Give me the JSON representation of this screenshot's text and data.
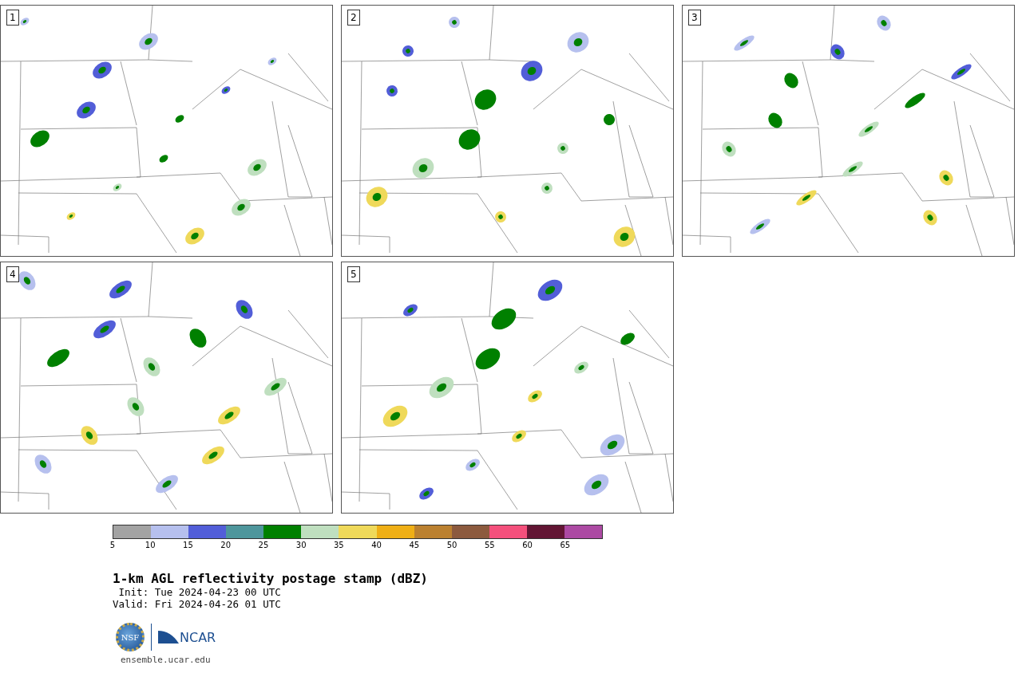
{
  "panels": [
    {
      "label": "1"
    },
    {
      "label": "2"
    },
    {
      "label": "3"
    },
    {
      "label": "4"
    },
    {
      "label": "5"
    }
  ],
  "colorbar": {
    "segments": [
      {
        "color": "#a3a3a3"
      },
      {
        "color": "#b6c0ee"
      },
      {
        "color": "#525ed8"
      },
      {
        "color": "#4e969c"
      },
      {
        "color": "#008000"
      },
      {
        "color": "#bfdfbf"
      },
      {
        "color": "#efd95a"
      },
      {
        "color": "#efaf16"
      },
      {
        "color": "#bb8130"
      },
      {
        "color": "#8c5a3e"
      },
      {
        "color": "#f4507c"
      },
      {
        "color": "#621634"
      },
      {
        "color": "#ac4aa3"
      }
    ],
    "ticks": [
      "5",
      "10",
      "15",
      "20",
      "25",
      "30",
      "35",
      "40",
      "45",
      "50",
      "55",
      "60",
      "65"
    ]
  },
  "title": "1-km AGL reflectivity postage stamp (dBZ)",
  "init": " Init: Tue 2024-04-23 00 UTC",
  "valid": "Valid: Fri 2024-04-26 01 UTC",
  "logos": {
    "nsf": "NSF",
    "ncar": "NCAR"
  },
  "site": "ensemble.ucar.edu"
}
